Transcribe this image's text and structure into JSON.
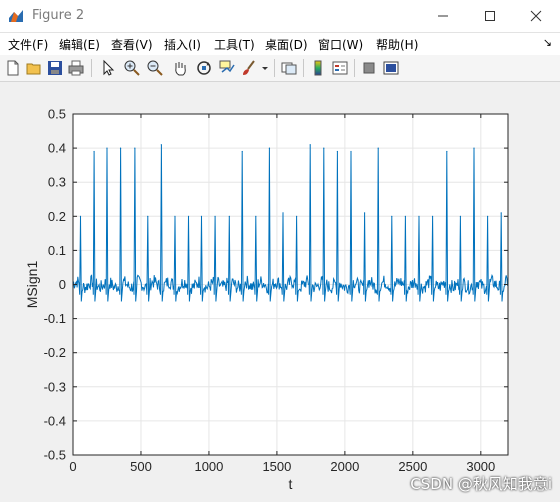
{
  "window": {
    "title": "Figure 2"
  },
  "menu": [
    "文件(F)",
    "编辑(E)",
    "查看(V)",
    "插入(I)",
    "工具(T)",
    "桌面(D)",
    "窗口(W)",
    "帮助(H)"
  ],
  "toolbar": [
    "new-figure-icon",
    "open-file-icon",
    "save-icon",
    "print-icon",
    "pointer-icon",
    "zoom-in-icon",
    "zoom-out-icon",
    "pan-hand-icon",
    "rotate-3d-icon",
    "data-cursor-icon",
    "brush-icon",
    "brush-dropdown-icon",
    "link-plot-icon",
    "colorbar-icon",
    "legend-icon",
    "hide-plot-tools-icon",
    "show-plot-tools-icon"
  ],
  "watermark": "CSDN @秋风知我意i",
  "chart_data": {
    "type": "line",
    "title": "",
    "xlabel": "t",
    "ylabel": "MSign1",
    "xlim": [
      0,
      3200
    ],
    "ylim": [
      -0.5,
      0.5
    ],
    "xticks": [
      "0",
      "500",
      "1000",
      "1500",
      "2000",
      "2500",
      "3000"
    ],
    "xtick_values": [
      0,
      500,
      1000,
      1500,
      2000,
      2500,
      3000
    ],
    "yticks": [
      "-0.5",
      "-0.4",
      "-0.3",
      "-0.2",
      "-0.1",
      "0",
      "0.1",
      "0.2",
      "0.3",
      "0.4",
      "0.5"
    ],
    "ytick_values": [
      -0.5,
      -0.4,
      -0.3,
      -0.2,
      -0.1,
      0,
      0.1,
      0.2,
      0.3,
      0.4,
      0.5
    ],
    "grid": true,
    "series": [
      {
        "color": "#0072bd",
        "baseline_noise": 0.02,
        "trough": -0.05,
        "peaks": [
          {
            "x": 55,
            "y": 0.2
          },
          {
            "x": 155,
            "y": 0.39
          },
          {
            "x": 250,
            "y": 0.4
          },
          {
            "x": 350,
            "y": 0.4
          },
          {
            "x": 455,
            "y": 0.4
          },
          {
            "x": 550,
            "y": 0.2
          },
          {
            "x": 650,
            "y": 0.41
          },
          {
            "x": 750,
            "y": 0.2
          },
          {
            "x": 850,
            "y": 0.2
          },
          {
            "x": 945,
            "y": 0.2
          },
          {
            "x": 1045,
            "y": 0.2
          },
          {
            "x": 1150,
            "y": 0.2
          },
          {
            "x": 1245,
            "y": 0.39
          },
          {
            "x": 1345,
            "y": 0.2
          },
          {
            "x": 1445,
            "y": 0.4
          },
          {
            "x": 1545,
            "y": 0.21
          },
          {
            "x": 1645,
            "y": 0.2
          },
          {
            "x": 1745,
            "y": 0.41
          },
          {
            "x": 1845,
            "y": 0.4
          },
          {
            "x": 1945,
            "y": 0.39
          },
          {
            "x": 2045,
            "y": 0.39
          },
          {
            "x": 2145,
            "y": 0.21
          },
          {
            "x": 2245,
            "y": 0.4
          },
          {
            "x": 2345,
            "y": 0.2
          },
          {
            "x": 2445,
            "y": 0.2
          },
          {
            "x": 2545,
            "y": 0.2
          },
          {
            "x": 2645,
            "y": 0.2
          },
          {
            "x": 2750,
            "y": 0.39
          },
          {
            "x": 2850,
            "y": 0.2
          },
          {
            "x": 2950,
            "y": 0.4
          },
          {
            "x": 3050,
            "y": 0.2
          },
          {
            "x": 3150,
            "y": 0.21
          }
        ]
      }
    ]
  }
}
